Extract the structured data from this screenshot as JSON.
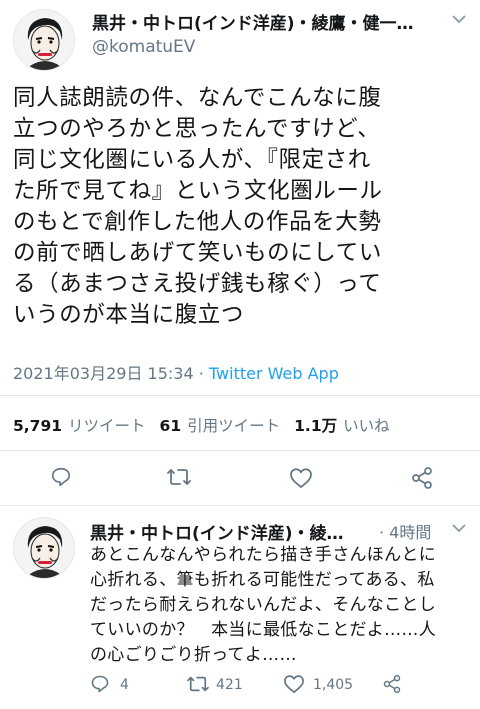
{
  "tweet": {
    "author_name": "黒井・中トロ(インド洋産)・綾鷹・健一…",
    "handle": "@komatuEV",
    "lines": [
      "同人誌朗読の件、なんでこんなに腹",
      "立つのやろかと思ったんですけど、",
      "同じ文化圏にいる人が、『限定され",
      "た所で見てね』という文化圏ルール",
      "のもとで創作した他人の作品を大勢",
      "の前で晒しあげて笑いものにしてい",
      "る（あまつさえ投げ銭も稼ぐ）って",
      "いうのが本当に腹立つ"
    ],
    "timestamp": "2021年03月29日 15:34 · ",
    "source": "Twitter Web App",
    "stats": {
      "retweets_count": "5,791",
      "retweets_label": "リツイート",
      "quotes_count": "61",
      "quotes_label": "引用ツイート",
      "likes_count": "1.1万",
      "likes_label": "いいね"
    }
  },
  "reply": {
    "author_name": "黒井・中トロ(インド洋産)・綾…",
    "time": "· 4時間",
    "lines": [
      "あとこんなんやられたら描き手さんほんとに",
      "心折れる、筆も折れる可能性だってある、私",
      "だったら耐えられないんだよ、そんなことし",
      "ていいのか？　本当に最低なことだよ……人",
      "の心ごりごり折ってよ……"
    ],
    "reply_count": "4",
    "retweet_count": "421",
    "like_count": "1,405"
  },
  "icons": [
    "reply-icon",
    "retweet-icon",
    "like-icon",
    "share-icon",
    "chevron-down-icon"
  ],
  "colors": {
    "link": "#1da1f2",
    "muted": "#657786",
    "text": "#14171a",
    "divider": "#e1e8ed"
  }
}
